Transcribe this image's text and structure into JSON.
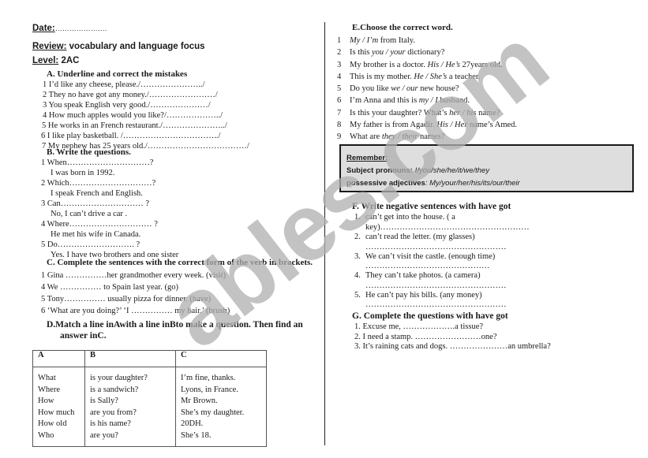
{
  "header": {
    "date_label": "Date:",
    "date_blank": "………………….",
    "review_label": "Review:",
    "review_text": " vocabulary and language focus",
    "level_label": "Level:",
    "level_value": " 2AC"
  },
  "sectionA": {
    "title": "A.  Underline and correct the mistakes",
    "items": [
      "1  I’d like any  cheese, please./…………………../",
      "2  They no have got  any money./……………………/",
      "3  You speak English very good./…………………/",
      "4  How much apples would you like?/………………../",
      "5 He works in an French restaurant./…………………../",
      "6 I like play basketball. /……………………………../",
      "7 My nephew  has 25 years old./………………………………/"
    ]
  },
  "sectionB": {
    "title": "B.   Write the questions.",
    "items": [
      {
        "q": "1  When…………………………?",
        "a": "I was born in 1992."
      },
      {
        "q": "2  Which…………………………?",
        "a": "I speak French and English."
      },
      {
        "q": "3  Can………………………… ?",
        "a": "No, I can’t drive a car ."
      },
      {
        "q": "4 Where………………………… ?",
        "a": "He met his wife in Canada."
      },
      {
        "q": "5     Do………………………. ?",
        "a": "Yes. I have two brothers and one sister"
      }
    ]
  },
  "sectionC": {
    "title": "C.  Complete the sentences with the correct form of the verb in brackets.",
    "items": [
      "1  Gina ……………her grandmother every week. (visit)",
      "4  We …………… to Spain  last year. (go)",
      "5  Tony…………… usually  pizza for dinner. (have)",
      "6  ‘What are you doing?’  ‘I …………… my hair.’ (brush)"
    ]
  },
  "sectionD": {
    "title_line1": "D.Match a line inAwith a line inBto make a question. Then find an",
    "title_line2": "answer inC.",
    "headers": [
      "A",
      "B",
      "C"
    ],
    "colA": [
      "What",
      "Where",
      "How",
      "How much",
      "How old",
      "Who"
    ],
    "colB": [
      "is your daughter?",
      "is a sandwich?",
      "is Sally?",
      "are you from?",
      "is his name?",
      "are you?"
    ],
    "colC": [
      "I’m fine, thanks.",
      "Lyons, in France.",
      "Mr Brown.",
      "She’s my daughter.",
      "20DH.",
      "She’s 18."
    ]
  },
  "sectionE": {
    "title": "E.Choose the correct word.",
    "items": [
      {
        "n": "1",
        "pre": "",
        "opt": "My / I’m",
        "post": " from Italy."
      },
      {
        "n": "2",
        "pre": "Is this ",
        "opt": "you / your",
        "post": " dictionary?"
      },
      {
        "n": "3",
        "pre": "My brother is a doctor. ",
        "opt": "His / He’s",
        "post": " 27years old."
      },
      {
        "n": "4",
        "pre": "This is my mother. ",
        "opt": "He / She’s",
        "post": " a teacher."
      },
      {
        "n": "5",
        "pre": "Do you like ",
        "opt": "we / our",
        "post": " new house?"
      },
      {
        "n": "6",
        "pre": "I’m Anna and this is ",
        "opt": "my / I",
        "post": " husband."
      },
      {
        "n": "7",
        "pre": "Is this your daughter? What’s ",
        "opt": "her / his",
        "post": " name?"
      },
      {
        "n": "8",
        "pre": "My father is from Agadir. ",
        "opt": "His / Her",
        "post": " name’s Amed."
      },
      {
        "n": "9",
        "pre": "What are ",
        "opt": "they / their",
        "post": " names?"
      }
    ]
  },
  "remember": {
    "title": "Remember:",
    "subject_label": "Subject pronouns: ",
    "subject_values": "I/you/she/he/it/we/they",
    "possessive_label": "possessive adjectives",
    "possessive_values": ": My/your/her/his/its/our/their",
    "box_color": "#dedede"
  },
  "sectionF": {
    "title": "F.   Write negative sentences with have got",
    "items": [
      {
        "n": "1.",
        "text": "can’t get into the house. ( a",
        "cont": "key)………………………………………………"
      },
      {
        "n": "2.",
        "text": "can’t read the letter. (my glasses)",
        "cont": "……………………………………………"
      },
      {
        "n": "3.",
        "text": "We can’t visit the castle. (enough time)",
        "cont": "………………………………………"
      },
      {
        "n": "4.",
        "text": "They can’t take photos. (a camera)",
        "cont": "……………………………………………"
      },
      {
        "n": "5.",
        "text": "He can’t pay his bills. (any money)",
        "cont": "……………………………………………"
      }
    ]
  },
  "sectionG": {
    "title": "G.  Complete the questions with have got",
    "items": [
      "1.  Excuse me, ……………….a tissue?",
      "2.  I need a stamp. ……………………one?",
      "3.  It’s raining cats and dogs. …………………an umbrella?"
    ]
  },
  "watermark": "ables.com"
}
